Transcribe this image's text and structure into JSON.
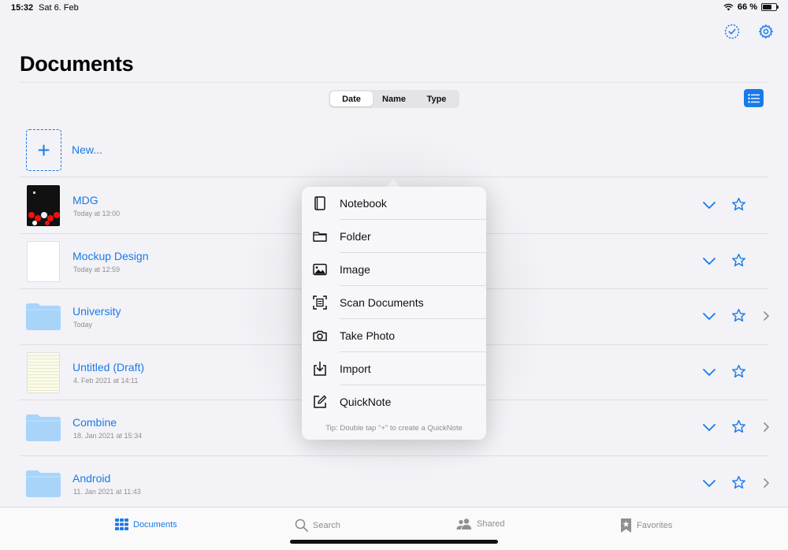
{
  "status": {
    "time": "15:32",
    "date": "Sat 6. Feb",
    "battery": "66 %",
    "battery_level": 0.66
  },
  "page": {
    "title": "Documents"
  },
  "sort": {
    "options": [
      "Date",
      "Name",
      "Type"
    ],
    "selected": "Date"
  },
  "new_item": {
    "label": "New..."
  },
  "documents": [
    {
      "name": "MDG",
      "date": "Today at 13:00",
      "kind": "doc-dark",
      "has_disclosure": false
    },
    {
      "name": "Mockup Design",
      "date": "Today at 12:59",
      "kind": "doc-white",
      "has_disclosure": false
    },
    {
      "name": "University",
      "date": "Today",
      "kind": "folder",
      "has_disclosure": true
    },
    {
      "name": "Untitled (Draft)",
      "date": "4. Feb 2021 at 14:11",
      "kind": "doc-draft",
      "has_disclosure": false
    },
    {
      "name": "Combine",
      "date": "18. Jan 2021 at 15:34",
      "kind": "folder",
      "has_disclosure": true
    },
    {
      "name": "Android",
      "date": "11. Jan 2021 at 11:43",
      "kind": "folder",
      "has_disclosure": true
    }
  ],
  "new_menu": {
    "items": [
      {
        "label": "Notebook",
        "icon": "notebook-icon"
      },
      {
        "label": "Folder",
        "icon": "folder-icon"
      },
      {
        "label": "Image",
        "icon": "image-icon"
      },
      {
        "label": "Scan Documents",
        "icon": "scan-icon"
      },
      {
        "label": "Take Photo",
        "icon": "camera-icon"
      },
      {
        "label": "Import",
        "icon": "import-icon"
      },
      {
        "label": "QuickNote",
        "icon": "quicknote-icon"
      }
    ],
    "tip": "Tip: Double tap \"+\" to create a QuickNote"
  },
  "tabs": [
    {
      "label": "Documents",
      "icon": "grid-icon",
      "active": true
    },
    {
      "label": "Search",
      "icon": "search-icon",
      "active": false
    },
    {
      "label": "Shared",
      "icon": "people-icon",
      "active": false
    },
    {
      "label": "Favorites",
      "icon": "bookmark-star-icon",
      "active": false
    }
  ],
  "colors": {
    "accent": "#1a7ae8",
    "folder": "#a8d4fa",
    "secondary": "#8e8e93"
  }
}
